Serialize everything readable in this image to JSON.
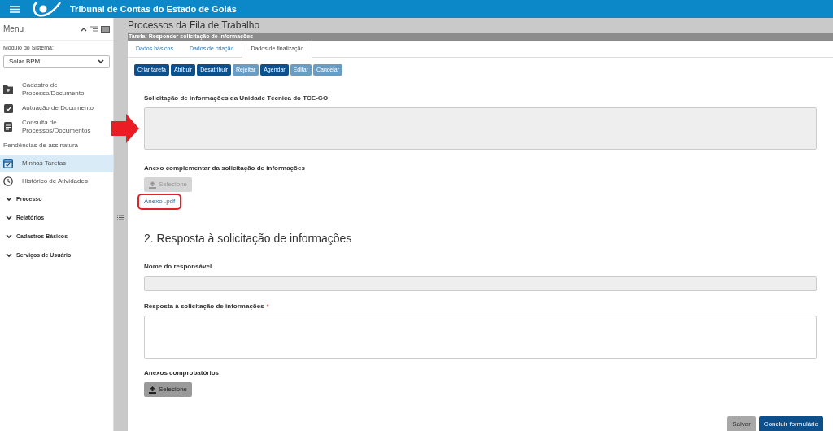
{
  "header": {
    "title": "Tribunal de Contas do Estado de Goiás"
  },
  "sidebar": {
    "title": "Menu",
    "module_label": "Módulo do Sistema:",
    "module_value": "Solar BPM",
    "items": [
      {
        "kind": "link",
        "label": "Cadastro de Processo/Documento",
        "selected": false
      },
      {
        "kind": "link",
        "label": "Autuação de Documento",
        "selected": false
      },
      {
        "kind": "link",
        "label": "Consulta de Processos/Documentos",
        "selected": false
      },
      {
        "kind": "plain",
        "label": "Pendências de assinatura",
        "selected": false
      },
      {
        "kind": "link",
        "label": "Minhas Tarefas",
        "selected": true
      },
      {
        "kind": "link",
        "label": "Histórico de Atividades",
        "selected": false
      },
      {
        "kind": "group",
        "label": "Processo",
        "selected": false
      },
      {
        "kind": "group",
        "label": "Relatórios",
        "selected": false
      },
      {
        "kind": "group",
        "label": "Cadastros Básicos",
        "selected": false
      },
      {
        "kind": "group",
        "label": "Serviços de Usuário",
        "selected": false
      }
    ]
  },
  "page_title": "Processos da Fila de Trabalho",
  "task_bar": "Tarefa: Responder solicitação de informações",
  "tabs": [
    {
      "label": "Dados básicos",
      "selected": false
    },
    {
      "label": "Dados de criação",
      "selected": false
    },
    {
      "label": "Dados de finalização",
      "selected": true
    }
  ],
  "actions": [
    {
      "label": "Criar tarefa",
      "disabled": false
    },
    {
      "label": "Atribuir",
      "disabled": false
    },
    {
      "label": "Desatribuir",
      "disabled": false
    },
    {
      "label": "Rejeitar",
      "disabled": true
    },
    {
      "label": "Agendar",
      "disabled": false
    },
    {
      "label": "Editar",
      "disabled": true
    },
    {
      "label": "Cancelar",
      "disabled": true
    }
  ],
  "request": {
    "label": "Solicitação de informações da Unidade Técnica do TCE-GO",
    "attachment_label": "Anexo complementar da solicitação de informações",
    "select_button": {
      "label": "Selecione",
      "disabled": true
    },
    "file_link": "Anexo .pdf"
  },
  "section2": {
    "heading": "2. Resposta à solicitação de informações",
    "responsible_label": "Nome do responsável",
    "response_label": "Resposta à solicitação de informações",
    "required_mark": "*",
    "proofs_label": "Anexos comprobatórios",
    "select_button": {
      "label": "Selecione",
      "disabled": false
    }
  },
  "footer_buttons": [
    {
      "label": "Salvar",
      "kind": "secondary"
    },
    {
      "label": "Concluir formulário",
      "kind": "primary"
    }
  ]
}
